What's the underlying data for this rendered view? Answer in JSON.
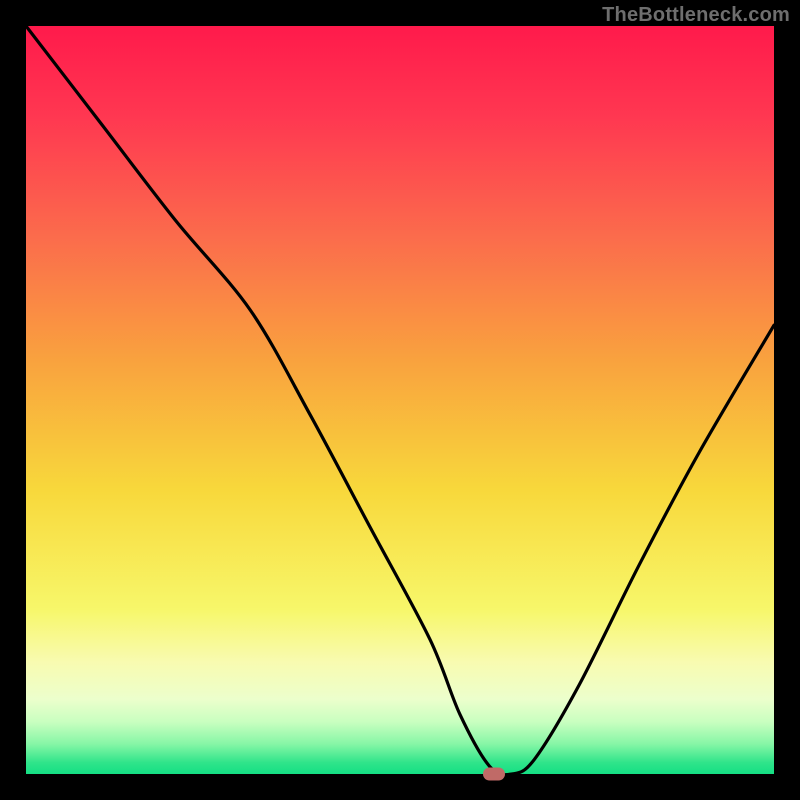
{
  "watermark": "TheBottleneck.com",
  "chart_data": {
    "type": "line",
    "title": "",
    "xlabel": "",
    "ylabel": "",
    "xlim": [
      0,
      100
    ],
    "ylim": [
      0,
      100
    ],
    "marker": {
      "x": 62.5,
      "y": 0
    },
    "series": [
      {
        "name": "bottleneck-curve",
        "x": [
          0,
          10,
          20,
          30,
          38,
          46,
          54,
          58,
          62,
          65,
          68,
          74,
          82,
          90,
          100
        ],
        "y": [
          100,
          87,
          74,
          62,
          48,
          33,
          18,
          8,
          1,
          0,
          2,
          12,
          28,
          43,
          60
        ]
      }
    ],
    "gradient_stops": [
      {
        "offset": 0.0,
        "color": "#ff1a4b"
      },
      {
        "offset": 0.12,
        "color": "#ff3751"
      },
      {
        "offset": 0.28,
        "color": "#fb6b4c"
      },
      {
        "offset": 0.45,
        "color": "#f9a33e"
      },
      {
        "offset": 0.62,
        "color": "#f8d83b"
      },
      {
        "offset": 0.78,
        "color": "#f7f76a"
      },
      {
        "offset": 0.85,
        "color": "#f8fbb0"
      },
      {
        "offset": 0.9,
        "color": "#ecffcc"
      },
      {
        "offset": 0.93,
        "color": "#c9ffc0"
      },
      {
        "offset": 0.96,
        "color": "#86f6a6"
      },
      {
        "offset": 0.985,
        "color": "#2fe48a"
      },
      {
        "offset": 1.0,
        "color": "#14df84"
      }
    ]
  }
}
